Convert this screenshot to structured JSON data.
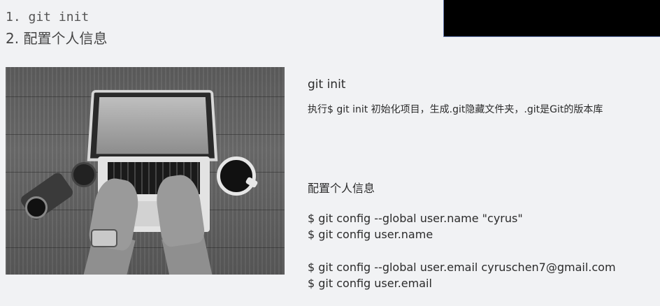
{
  "outline": {
    "items": [
      "1. git init",
      "2. 配置个人信息"
    ]
  },
  "section_git_init": {
    "title": "git init",
    "description": "执行$ git init 初始化项目，生成.git隐藏文件夹，.git是Git的版本库"
  },
  "section_config": {
    "title": "配置个人信息",
    "commands": [
      "$ git config --global user.name \"cyrus\"",
      "$ git config user.name",
      "$ git config --global user.email cyruschen7@gmail.com",
      "$ git config user.email"
    ]
  },
  "colors": {
    "background": "#f1f2f4",
    "text": "#2b2b2b",
    "overlay": "#000000"
  }
}
